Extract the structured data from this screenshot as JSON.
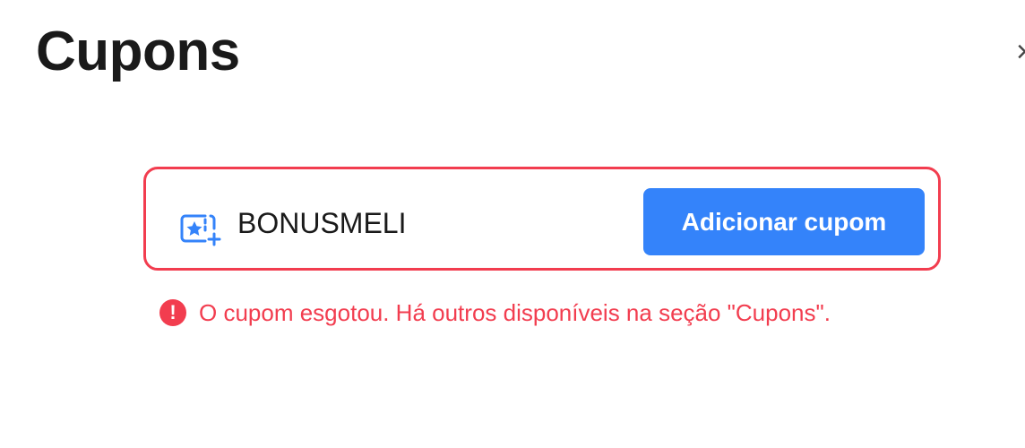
{
  "header": {
    "title": "Cupons",
    "close_label": "×"
  },
  "coupon_form": {
    "code_value": "BONUSMELI",
    "add_button_label": "Adicionar cupom",
    "coupon_icon": "coupon-add-icon"
  },
  "error": {
    "icon_glyph": "!",
    "message": "O cupom esgotou. Há outros disponíveis na seção \"Cupons\"."
  },
  "colors": {
    "accent": "#3483fa",
    "error": "#f23d4f",
    "text": "#1a1a1a"
  }
}
